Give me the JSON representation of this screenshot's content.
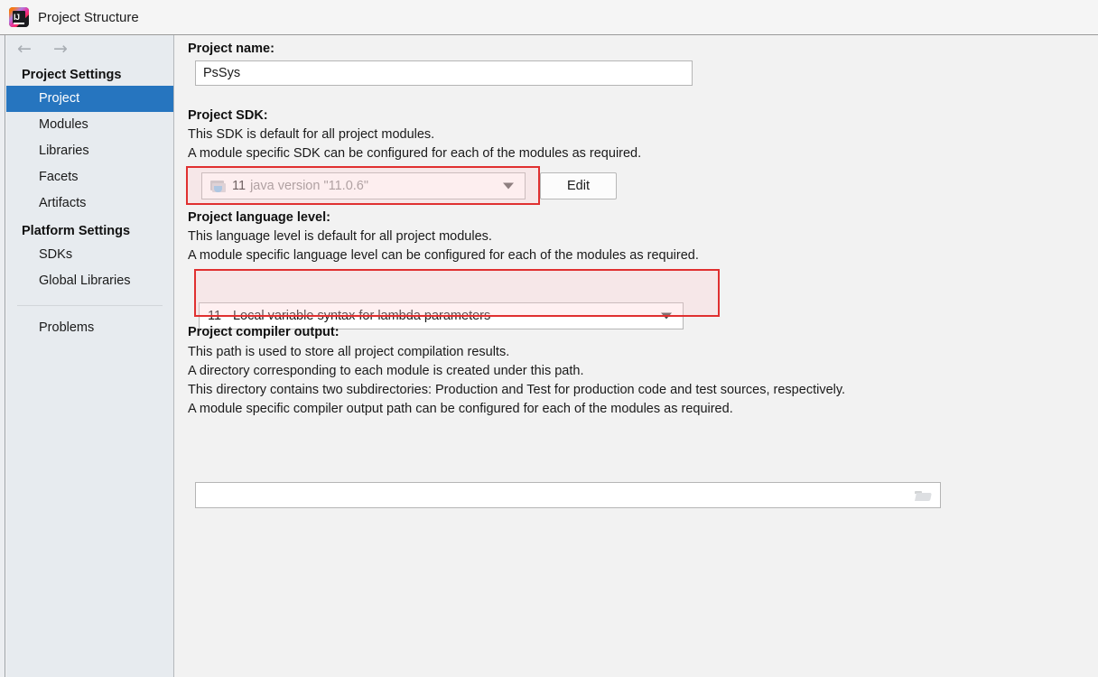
{
  "window": {
    "title": "Project Structure",
    "logo_icon": "intellij-idea-logo"
  },
  "sidebar": {
    "nav": {
      "back_icon": "arrow-left-icon",
      "forward_icon": "arrow-right-icon"
    },
    "groups": [
      {
        "title": "Project Settings",
        "items": [
          {
            "label": "Project",
            "selected": true
          },
          {
            "label": "Modules",
            "selected": false
          },
          {
            "label": "Libraries",
            "selected": false
          },
          {
            "label": "Facets",
            "selected": false
          },
          {
            "label": "Artifacts",
            "selected": false
          }
        ]
      },
      {
        "title": "Platform Settings",
        "items": [
          {
            "label": "SDKs",
            "selected": false
          },
          {
            "label": "Global Libraries",
            "selected": false
          }
        ]
      }
    ],
    "footer_item": {
      "label": "Problems"
    }
  },
  "main": {
    "project_name": {
      "label": "Project name:",
      "value": "PsSys",
      "placeholder": ""
    },
    "project_sdk": {
      "label": "Project SDK:",
      "desc_line_1": "This SDK is default for all project modules.",
      "desc_line_2": "A module specific SDK can be configured for each of the modules as required.",
      "selected_version": "11",
      "selected_detail": "java version \"11.0.6\"",
      "sdk_icon": "java-sdk-icon",
      "dropdown_icon": "chevron-down-icon",
      "edit_button": "Edit"
    },
    "language_level": {
      "label": "Project language level:",
      "desc_line_1": "This language level is default for all project modules.",
      "desc_line_2": "A module specific language level can be configured for each of the modules as required.",
      "selected": "11 - Local variable syntax for lambda parameters",
      "dropdown_icon": "chevron-down-icon"
    },
    "compiler_output": {
      "label": "Project compiler output:",
      "desc_line_1": "This path is used to store all project compilation results.",
      "desc_line_2": "A directory corresponding to each module is created under this path.",
      "desc_line_3": "This directory contains two subdirectories: Production and Test for production code and test sources, respectively.",
      "desc_line_4": "A module specific compiler output path can be configured for each of the modules as required.",
      "value": "",
      "placeholder": "",
      "browse_icon": "folder-browse-icon"
    }
  },
  "annotations": {
    "highlight_color": "#e03030",
    "boxes": [
      {
        "name": "sdk-combo-highlight"
      },
      {
        "name": "language-level-highlight"
      }
    ]
  },
  "colors": {
    "accent_selection": "#2675bf",
    "sidebar_bg": "#e7ebef",
    "content_bg": "#f2f2f2",
    "titlebar_bg": "#f5f5f5",
    "annotation_red": "#e03030"
  }
}
